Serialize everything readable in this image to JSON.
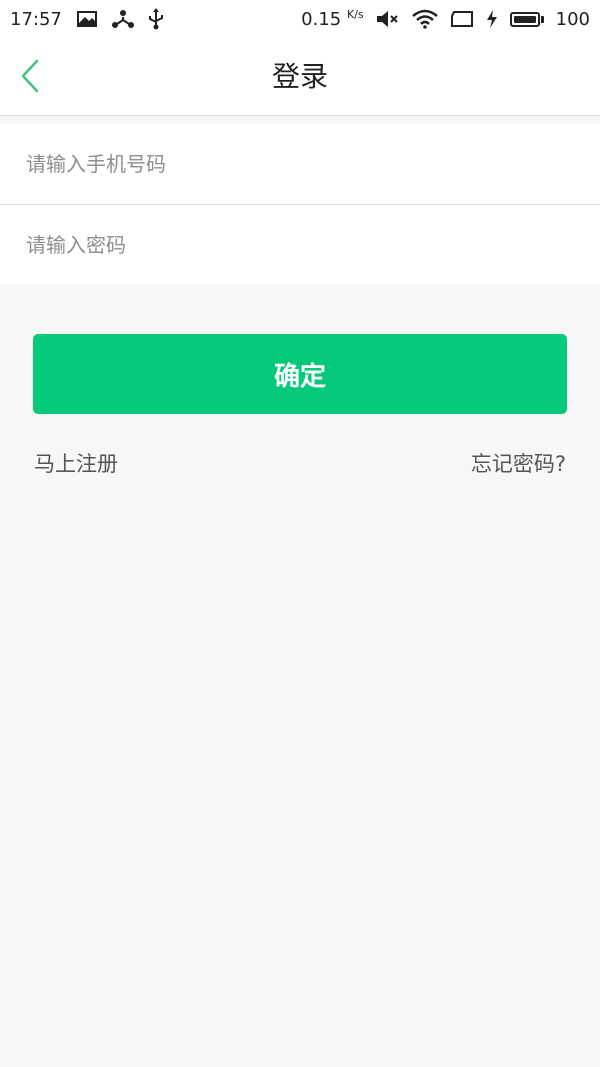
{
  "status_bar": {
    "time": "17:57",
    "net_speed_value": "0.15",
    "net_speed_unit": "K/s",
    "battery_level": "100",
    "icons": [
      "image-icon",
      "network-share-icon",
      "usb-icon",
      "mute-icon",
      "wifi-icon",
      "screen-rotate-icon",
      "charging-icon",
      "battery-icon"
    ]
  },
  "nav": {
    "title": "登录",
    "back_icon": "chevron-left-icon",
    "accent_color": "#3ec27e"
  },
  "form": {
    "phone_placeholder": "请输入手机号码",
    "phone_value": "",
    "password_placeholder": "请输入密码",
    "password_value": ""
  },
  "actions": {
    "confirm_label": "确定",
    "confirm_color": "#05c97a",
    "register_label": "马上注册",
    "forgot_label": "忘记密码?"
  }
}
